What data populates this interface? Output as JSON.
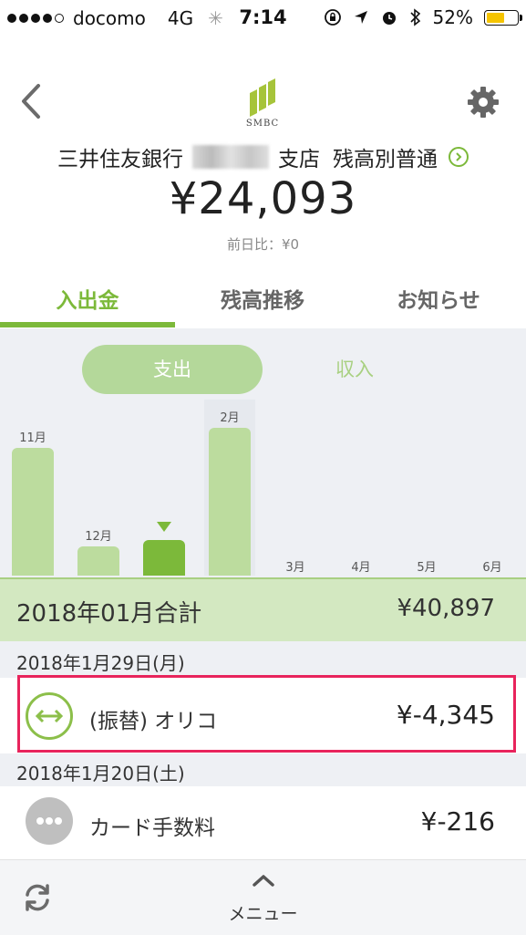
{
  "status_bar": {
    "carrier": "docomo",
    "network": "4G",
    "time": "7:14",
    "battery": "52%",
    "battery_level": 0.52
  },
  "header": {
    "logo_text": "SMBC",
    "bank_name": "三井住友銀行",
    "branch_suffix": "支店",
    "account_type": "残高別普通",
    "balance": "¥24,093",
    "diff": "前日比：¥0"
  },
  "tabs": [
    {
      "label": "入出金",
      "active": true
    },
    {
      "label": "残高推移",
      "active": false
    },
    {
      "label": "お知らせ",
      "active": false
    }
  ],
  "toggle": {
    "expense": "支出",
    "income": "収入"
  },
  "chart_data": {
    "type": "bar",
    "categories": [
      "11月",
      "12月",
      "1月",
      "2月",
      "3月",
      "4月",
      "5月",
      "6月"
    ],
    "category_labels_shown": [
      "11月",
      "12月",
      "",
      "2月",
      "3月",
      "4月",
      "5月",
      "6月"
    ],
    "values": [
      52000,
      12000,
      14500,
      60000,
      0,
      0,
      0,
      0
    ],
    "selected_index": 2,
    "colors": {
      "bar": "#bcdc9e",
      "selected": "#7cb93a"
    }
  },
  "total": {
    "label": "2018年01月合計",
    "amount": "¥40,897"
  },
  "groups": [
    {
      "date": "2018年1月29日(月)",
      "items": [
        {
          "name": "(振替) オリコ",
          "amount": "¥-4,345",
          "icon": "transfer-icon"
        }
      ]
    },
    {
      "date": "2018年1月20日(土)",
      "items": [
        {
          "name": "カード手数料",
          "amount": "¥-216",
          "icon": "more-icon"
        }
      ]
    }
  ],
  "bottom": {
    "menu_label": "メニュー"
  },
  "colors": {
    "accent": "#7cb93a",
    "highlight": "#e8245c"
  }
}
